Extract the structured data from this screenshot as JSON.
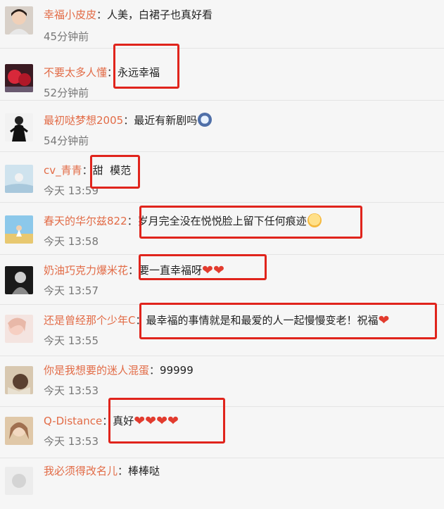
{
  "comments": [
    {
      "user": "幸福小皮皮",
      "text": "人美，白裙子也真好看",
      "time": "45分钟前"
    },
    {
      "user": "不要太多人懂",
      "text": "永远幸福",
      "time": "52分钟前"
    },
    {
      "user": "最初哒梦想2005",
      "text": "最近有新剧吗",
      "time": "54分钟前",
      "emoji": "scared-face-icon"
    },
    {
      "user": "cv_青青",
      "text": "甜  模范",
      "time": "今天 13:59"
    },
    {
      "user": "春天的华尔兹822",
      "text": "岁月完全没在悦悦脸上留下任何痕迹",
      "time": "今天 13:58",
      "emoji": "hugging-face-icon"
    },
    {
      "user": "奶油巧克力爆米花",
      "text": "要一直幸福呀",
      "time": "今天 13:57",
      "hearts": "❤❤"
    },
    {
      "user": "还是曾经那个少年C",
      "text": "最幸福的事情就是和最爱的人一起慢慢变老！祝福",
      "time": "今天 13:55",
      "hearts": "❤"
    },
    {
      "user": "你是我想要的迷人混蛋",
      "text": "99999",
      "time": "今天 13:53"
    },
    {
      "user": "Q-Distance",
      "text": "真好",
      "time": "今天 13:53",
      "hearts": "❤❤❤❤"
    },
    {
      "user": "我必须得改名儿",
      "text": "棒棒哒",
      "time": ""
    }
  ],
  "separator": "：",
  "colors": {
    "username": "#e26b46",
    "highlight": "#e0241c",
    "heart": "#e23b2e"
  }
}
